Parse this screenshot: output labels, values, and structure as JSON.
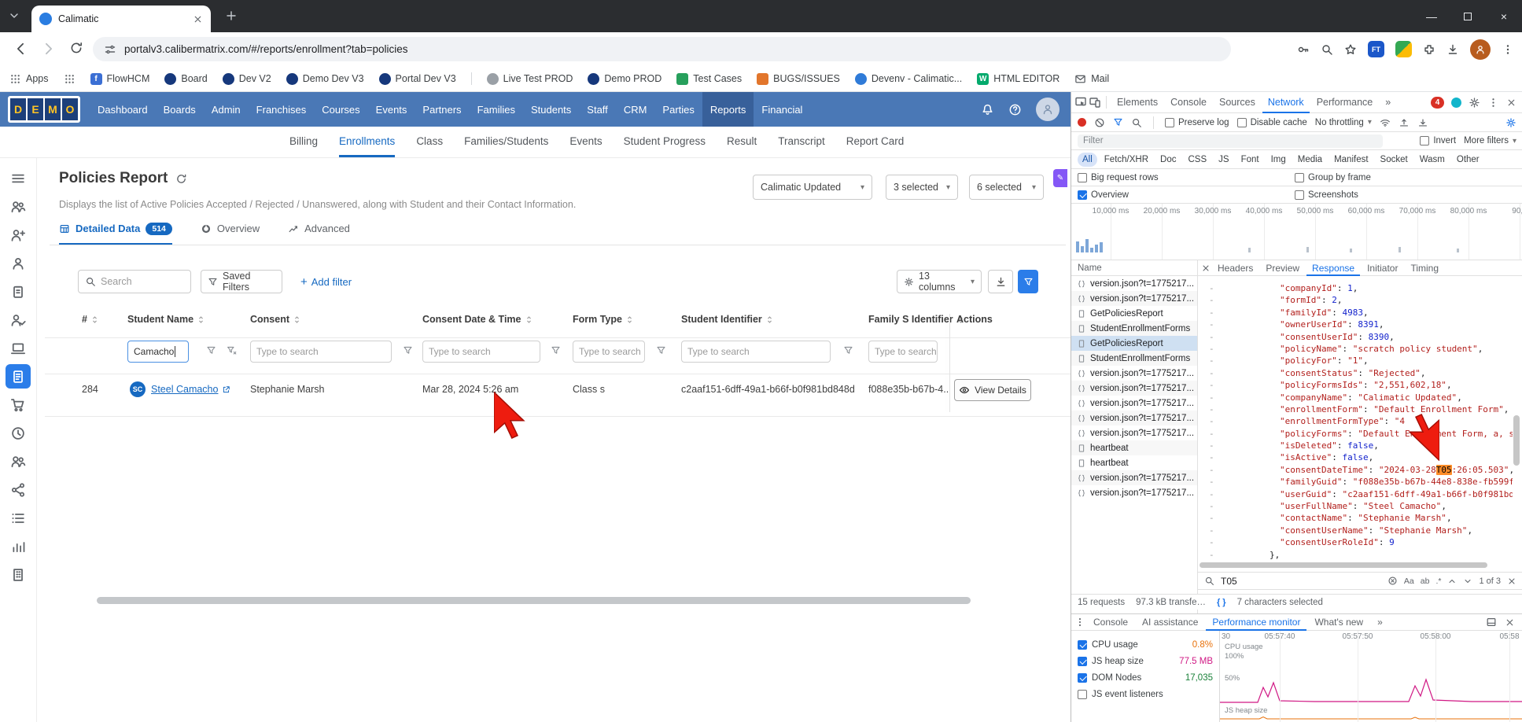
{
  "browser": {
    "tab_title": "Calimatic",
    "url": "portalv3.calibermatrix.com/#/reports/enrollment?tab=policies",
    "bookmarks": [
      {
        "label": "Apps",
        "type": "grid"
      },
      {
        "label": "",
        "type": "grid"
      },
      {
        "label": "FlowHCM",
        "type": "letter",
        "color": "#3b6fd4",
        "letter": "f"
      },
      {
        "label": "Board",
        "type": "dot",
        "color": "#16387c"
      },
      {
        "label": "Dev V2",
        "type": "dot",
        "color": "#16387c"
      },
      {
        "label": "Demo Dev V3",
        "type": "dot",
        "color": "#16387c"
      },
      {
        "label": "Portal Dev V3",
        "type": "dot",
        "color": "#16387c"
      },
      {
        "label": "Live Test PROD",
        "type": "dot",
        "color": "#9aa0a6",
        "sep": true
      },
      {
        "label": "Demo PROD",
        "type": "dot",
        "color": "#16387c"
      },
      {
        "label": "Test Cases",
        "type": "square",
        "color": "#27a05c"
      },
      {
        "label": "BUGS/ISSUES",
        "type": "square",
        "color": "#e2762c"
      },
      {
        "label": "Devenv - Calimatic...",
        "type": "dot",
        "color": "#2f7bd8"
      },
      {
        "label": "HTML EDITOR",
        "type": "letter",
        "color": "#04aa6d",
        "letter": "W"
      },
      {
        "label": "Mail",
        "type": "mail"
      }
    ]
  },
  "app": {
    "logo_letters": [
      "D",
      "E",
      "M",
      "O"
    ],
    "nav_items": [
      "Dashboard",
      "Boards",
      "Admin",
      "Franchises",
      "Courses",
      "Events",
      "Partners",
      "Families",
      "Students",
      "Staff",
      "CRM",
      "Parties",
      "Reports",
      "Financial"
    ],
    "nav_active": "Reports",
    "subnav_items": [
      "Billing",
      "Enrollments",
      "Class",
      "Families/Students",
      "Events",
      "Student Progress",
      "Result",
      "Transcript",
      "Report Card"
    ],
    "subnav_active": "Enrollments",
    "rail_icons": [
      "menu",
      "people",
      "person-plus",
      "person",
      "clipboard",
      "person-check",
      "laptop",
      "doc",
      "cart",
      "clock",
      "people",
      "share",
      "list",
      "chart",
      "building"
    ],
    "rail_active_index": 7
  },
  "report": {
    "title": "Policies Report",
    "description": "Displays the list of Active Policies Accepted / Rejected / Unanswered, along with Student and their Contact Information.",
    "selects": [
      {
        "value": "Calimatic Updated"
      },
      {
        "value": "3 selected"
      },
      {
        "value": "6 selected"
      }
    ],
    "tabs": [
      {
        "label": "Detailed Data",
        "badge": "514",
        "icon": "table",
        "active": true
      },
      {
        "label": "Overview",
        "icon": "donut",
        "active": false
      },
      {
        "label": "Advanced",
        "icon": "trend",
        "active": false
      }
    ],
    "toolbar": {
      "search_placeholder": "Search",
      "saved_filters": "Saved Filters",
      "add_filter": "Add filter",
      "columns": "13 columns"
    },
    "table": {
      "columns": [
        {
          "label": "#",
          "sortable": true
        },
        {
          "label": "Student Name",
          "sortable": true
        },
        {
          "label": "Consent",
          "sortable": true
        },
        {
          "label": "Consent Date & Time",
          "sortable": true
        },
        {
          "label": "Form Type",
          "sortable": true
        },
        {
          "label": "Student Identifier",
          "sortable": true
        },
        {
          "label": "Family S Identifier",
          "sortable": true
        },
        {
          "label": "Actions",
          "sortable": false
        }
      ],
      "filter_row": {
        "student_name_value": "Camacho",
        "placeholder": "Type to search"
      },
      "rows": [
        {
          "num": "284",
          "avatar": "SC",
          "student_name": "Steel Camacho",
          "consent": "Stephanie Marsh",
          "consent_date": "Mar 28, 2024 5:26 am",
          "form_type": "Class s",
          "student_identifier": "c2aaf151-6dff-49a1-b66f-b0f981bd848d",
          "family_identifier": "f088e35b-b67b-4...",
          "action": "View Details"
        }
      ]
    }
  },
  "devtools": {
    "tabs": [
      "Elements",
      "Console",
      "Sources",
      "Network",
      "Performance"
    ],
    "active_tab": "Network",
    "issues_badge": "4",
    "controls": {
      "preserve_log": "Preserve log",
      "disable_cache": "Disable cache",
      "throttling": "No throttling",
      "filter_placeholder": "Filter",
      "invert": "Invert",
      "more_filters": "More filters"
    },
    "chips": [
      "All",
      "Fetch/XHR",
      "Doc",
      "CSS",
      "JS",
      "Font",
      "Img",
      "Media",
      "Manifest",
      "Socket",
      "Wasm",
      "Other"
    ],
    "active_chip": "All",
    "toggles": [
      {
        "label": "Big request rows",
        "checked": false
      },
      {
        "label": "Group by frame",
        "checked": false
      },
      {
        "label": "Overview",
        "checked": true
      },
      {
        "label": "Screenshots",
        "checked": false
      }
    ],
    "timeline_labels": [
      "10,000 ms",
      "20,000 ms",
      "30,000 ms",
      "40,000 ms",
      "50,000 ms",
      "60,000 ms",
      "70,000 ms",
      "80,000 ms",
      "90,0"
    ],
    "requests_header": "Name",
    "requests": [
      {
        "name": "version.json?t=1775217...",
        "icon": "json",
        "selected": false
      },
      {
        "name": "version.json?t=1775217...",
        "icon": "json",
        "selected": false
      },
      {
        "name": "GetPoliciesReport",
        "icon": "doc",
        "selected": false
      },
      {
        "name": "StudentEnrollmentForms",
        "icon": "doc",
        "selected": false
      },
      {
        "name": "GetPoliciesReport",
        "icon": "doc",
        "selected": true
      },
      {
        "name": "StudentEnrollmentForms",
        "icon": "doc",
        "selected": false
      },
      {
        "name": "version.json?t=1775217...",
        "icon": "json",
        "selected": false
      },
      {
        "name": "version.json?t=1775217...",
        "icon": "json",
        "selected": false
      },
      {
        "name": "version.json?t=1775217...",
        "icon": "json",
        "selected": false
      },
      {
        "name": "version.json?t=1775217...",
        "icon": "json",
        "selected": false
      },
      {
        "name": "version.json?t=1775217...",
        "icon": "json",
        "selected": false
      },
      {
        "name": "heartbeat",
        "icon": "doc",
        "selected": false
      },
      {
        "name": "heartbeat",
        "icon": "doc",
        "selected": false
      },
      {
        "name": "version.json?t=1775217...",
        "icon": "json",
        "selected": false
      },
      {
        "name": "version.json?t=1775217...",
        "icon": "json",
        "selected": false
      }
    ],
    "response_tabs": [
      "Headers",
      "Preview",
      "Response",
      "Initiator",
      "Timing"
    ],
    "active_response_tab": "Response",
    "json_lines": [
      {
        "key": "companyId",
        "value": "1",
        "type": "num"
      },
      {
        "key": "formId",
        "value": "2",
        "type": "num"
      },
      {
        "key": "familyId",
        "value": "4983",
        "type": "num"
      },
      {
        "key": "ownerUserId",
        "value": "8391",
        "type": "num"
      },
      {
        "key": "consentUserId",
        "value": "8390",
        "type": "num"
      },
      {
        "key": "policyName",
        "value": "scratch policy student",
        "type": "str"
      },
      {
        "key": "policyFor",
        "value": "1",
        "type": "str"
      },
      {
        "key": "consentStatus",
        "value": "Rejected",
        "type": "str"
      },
      {
        "key": "policyFormsIds",
        "value": "2,551,602,18",
        "type": "str"
      },
      {
        "key": "companyName",
        "value": "Calimatic Updated",
        "type": "str"
      },
      {
        "key": "enrollmentForm",
        "value": "Default Enrollment Form",
        "type": "str"
      },
      {
        "key": "enrollmentFormType",
        "value": "4",
        "type": "str",
        "cut": true
      },
      {
        "key": "policyForms",
        "value": "Default Enrollment Form, a, s",
        "type": "str",
        "cut": true
      },
      {
        "key": "isDeleted",
        "value": "false",
        "type": "bool"
      },
      {
        "key": "isActive",
        "value": "false",
        "type": "bool"
      },
      {
        "key": "consentDateTime",
        "type": "str",
        "pre": "2024-03-28",
        "match": "T05",
        "post": ":26:05.503"
      },
      {
        "key": "familyGuid",
        "value": "f088e35b-b67b-44e8-838e-fb599f",
        "type": "str",
        "cut": true
      },
      {
        "key": "userGuid",
        "value": "c2aaf151-6dff-49a1-b66f-b0f981bd",
        "type": "str",
        "cut": true
      },
      {
        "key": "userFullName",
        "value": "Steel Camacho",
        "type": "str"
      },
      {
        "key": "contactName",
        "value": "Stephanie Marsh",
        "type": "str"
      },
      {
        "key": "consentUserName",
        "value": "Stephanie Marsh",
        "type": "str"
      },
      {
        "key": "consentUserRoleId",
        "value": "9",
        "type": "num",
        "no_comma": true
      },
      {
        "close": "},"
      }
    ],
    "search": {
      "query": "T05",
      "count": "1 of 3",
      "match_options": [
        "Aa",
        "ab",
        ".*"
      ]
    },
    "summary": {
      "requests": "15 requests",
      "transferred": "97.3 kB transfe…",
      "format_icon": "{ }",
      "selected": "7 characters selected"
    },
    "drawer_tabs": [
      "Console",
      "AI assistance",
      "Performance monitor",
      "What's new"
    ],
    "active_drawer_tab": "Performance monitor",
    "perf": {
      "metrics": [
        {
          "label": "CPU usage",
          "value": "0.8%",
          "color": "#e8710a",
          "checked": true
        },
        {
          "label": "JS heap size",
          "value": "77.5 MB",
          "color": "#d01884",
          "checked": true
        },
        {
          "label": "DOM Nodes",
          "value": "17,035",
          "color": "#188038",
          "checked": true
        },
        {
          "label": "JS event listeners",
          "value": "",
          "color": "#5f6368",
          "checked": false
        }
      ],
      "time_labels": [
        "30",
        "05:57:40",
        "05:57:50",
        "05:58:00",
        "05:58"
      ],
      "axis": {
        "cpu": "CPU usage",
        "p100": "100%",
        "p50": "50%",
        "heap": "JS heap size"
      }
    }
  }
}
